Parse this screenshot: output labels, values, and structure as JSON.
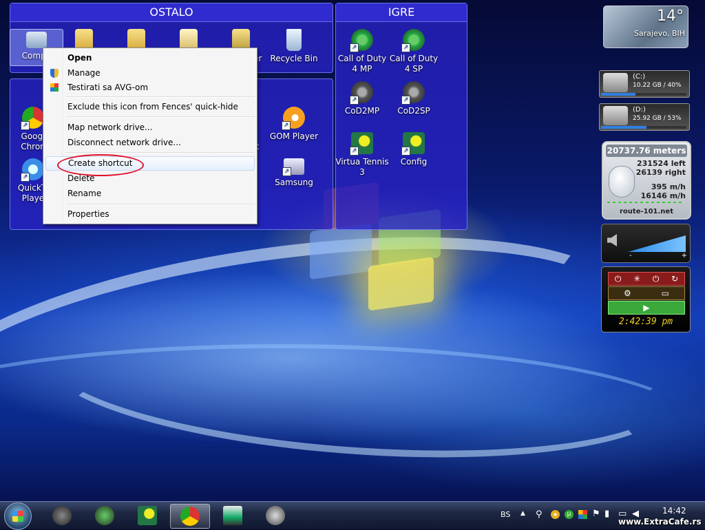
{
  "fences": {
    "ostalo": {
      "title": "OSTALO",
      "icons": [
        {
          "label": "Computer",
          "visible": "Compu"
        },
        {
          "label": "",
          "visible": ""
        },
        {
          "label": "",
          "visible": ""
        },
        {
          "label": "",
          "visible": ""
        },
        {
          "label": "er",
          "visible": "er"
        },
        {
          "label": "Recycle Bin",
          "visible": "Recycle Bin"
        }
      ]
    },
    "second": {
      "icons": [
        {
          "label": "Googl\nChron"
        },
        {
          "label": "GOM Player"
        },
        {
          "label": "QuickTi\nPlaye"
        },
        {
          "label": "Samsung"
        }
      ]
    },
    "igre": {
      "title": "IGRE",
      "icons": [
        {
          "label": "Call of Duty 4 MP"
        },
        {
          "label": "Call of Duty 4 SP"
        },
        {
          "label": "CoD2MP"
        },
        {
          "label": "CoD2SP"
        },
        {
          "label": "Virtua Tennis 3"
        },
        {
          "label": "Config"
        }
      ]
    }
  },
  "context_menu": {
    "items": [
      {
        "label": "Open",
        "bold": true
      },
      {
        "label": "Manage",
        "icon": "shield-icon"
      },
      {
        "label": "Testirati sa AVG-om",
        "icon": "avg-icon"
      },
      {
        "label": "Exclude this icon from Fences' quick-hide"
      },
      {
        "label": "Map network drive..."
      },
      {
        "label": "Disconnect network drive..."
      },
      {
        "label": "Create shortcut",
        "highlighted": true
      },
      {
        "label": "Delete"
      },
      {
        "label": "Rename"
      },
      {
        "label": "Properties"
      }
    ]
  },
  "gadgets": {
    "weather": {
      "temp": "14°",
      "location": "Sarajevo, BIH"
    },
    "drive_c": {
      "name": "(C:)",
      "info": "10.22 GB / 40%",
      "fill": 0.4
    },
    "drive_d": {
      "name": "(D:)",
      "info": "25.92 GB / 53%",
      "fill": 0.53
    },
    "mouse_meter": {
      "distance": "20737.76 meters",
      "left": "231524",
      "left_label": "left",
      "right": "26139",
      "right_label": "right",
      "speed1": "395",
      "speed2": "16146",
      "unit": "m/h",
      "site": "route-101.net"
    },
    "volume": {
      "minus": "-",
      "plus": "+"
    },
    "power": {
      "time": "2:42:39 pm"
    }
  },
  "taskbar": {
    "language": "BS",
    "clock": "14:42",
    "watermark": "www.ExtraCafe.rs"
  },
  "colors": {
    "fence_bg": "#2c24c8",
    "highlight_circle": "#e0102a",
    "power_green": "#3aa83a",
    "clock_yellow": "#f0d020"
  }
}
